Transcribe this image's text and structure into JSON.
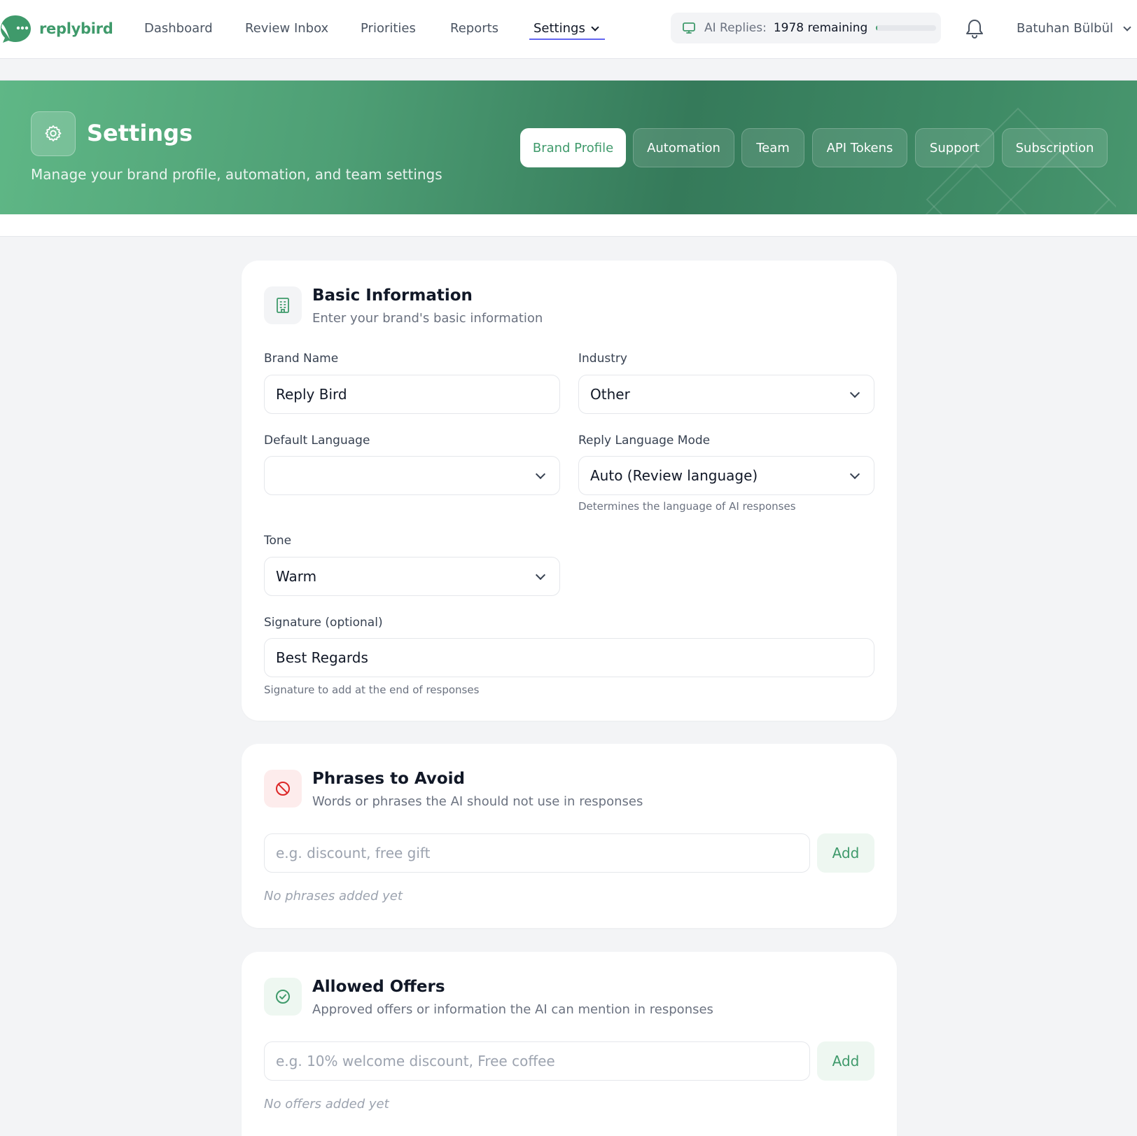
{
  "brand": {
    "name": "replybird",
    "accent": "#3f9a6b"
  },
  "nav": {
    "items": [
      {
        "label": "Dashboard"
      },
      {
        "label": "Review Inbox"
      },
      {
        "label": "Priorities"
      },
      {
        "label": "Reports"
      },
      {
        "label": "Settings"
      }
    ],
    "active": "Settings",
    "credits": {
      "label": "AI Replies:",
      "value": "1978 remaining",
      "fill": 0.02
    },
    "user": "Batuhan Bülbül"
  },
  "banner": {
    "title": "Settings",
    "subtitle": "Manage your brand profile, automation, and team settings",
    "tabs": [
      {
        "label": "Brand Profile"
      },
      {
        "label": "Automation"
      },
      {
        "label": "Team"
      },
      {
        "label": "API Tokens"
      },
      {
        "label": "Support"
      },
      {
        "label": "Subscription"
      }
    ],
    "active_tab": "Brand Profile"
  },
  "basic": {
    "title": "Basic Information",
    "subtitle": "Enter your brand's basic information",
    "brand_name": {
      "label": "Brand Name",
      "value": "Reply Bird"
    },
    "industry": {
      "label": "Industry",
      "value": "Other"
    },
    "default_language": {
      "label": "Default Language",
      "value": ""
    },
    "reply_mode": {
      "label": "Reply Language Mode",
      "value": "Auto (Review language)",
      "hint": "Determines the language of AI responses"
    },
    "tone": {
      "label": "Tone",
      "value": "Warm"
    },
    "signature": {
      "label": "Signature (optional)",
      "value": "Best Regards",
      "hint": "Signature to add at the end of responses"
    }
  },
  "avoid": {
    "title": "Phrases to Avoid",
    "subtitle": "Words or phrases the AI should not use in responses",
    "placeholder": "e.g. discount, free gift",
    "add_label": "Add",
    "empty": "No phrases added yet"
  },
  "offers": {
    "title": "Allowed Offers",
    "subtitle": "Approved offers or information the AI can mention in responses",
    "placeholder": "e.g. 10% welcome discount, Free coffee",
    "add_label": "Add",
    "empty": "No offers added yet"
  }
}
